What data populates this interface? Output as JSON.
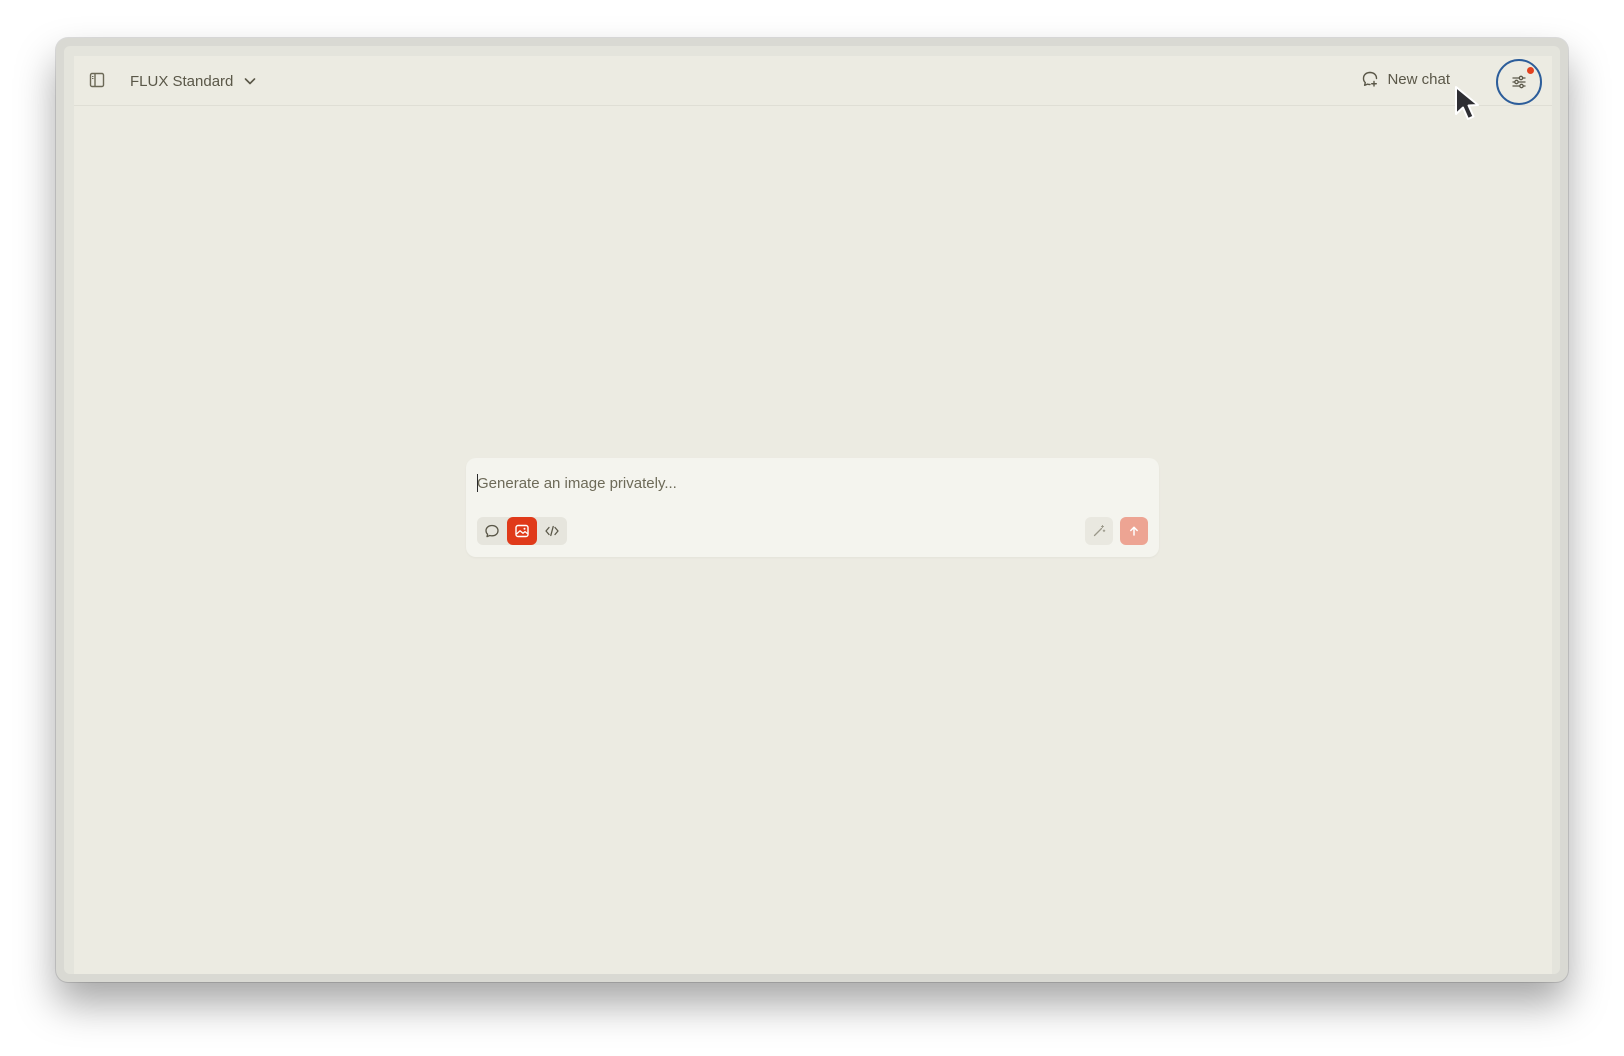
{
  "header": {
    "model_name": "FLUX Standard",
    "new_chat_label": "New chat"
  },
  "composer": {
    "placeholder": "Generate an image privately...",
    "value": "",
    "modes": [
      {
        "name": "chat",
        "icon": "speech-bubble-icon",
        "active": false
      },
      {
        "name": "image",
        "icon": "image-icon",
        "active": true
      },
      {
        "name": "code",
        "icon": "code-brackets-icon",
        "active": false
      }
    ]
  },
  "colors": {
    "background": "#ecebe2",
    "accent": "#e03a1a",
    "send_disabled": "#eda493",
    "focus_ring": "#2c5d9a"
  }
}
